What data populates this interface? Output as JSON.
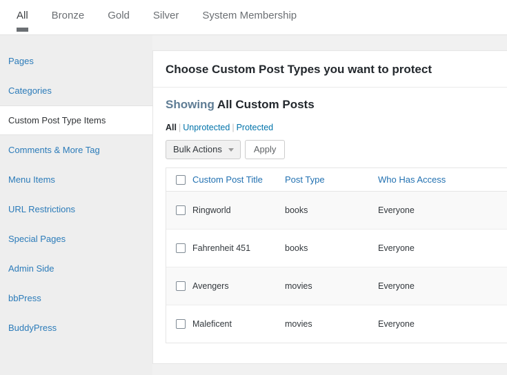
{
  "tabs": [
    {
      "label": "All",
      "active": true
    },
    {
      "label": "Bronze",
      "active": false
    },
    {
      "label": "Gold",
      "active": false
    },
    {
      "label": "Silver",
      "active": false
    },
    {
      "label": "System Membership",
      "active": false
    }
  ],
  "sidebar": {
    "items": [
      {
        "label": "Pages",
        "active": false
      },
      {
        "label": "Categories",
        "active": false
      },
      {
        "label": "Custom Post Type Items",
        "active": true
      },
      {
        "label": "Comments & More Tag",
        "active": false
      },
      {
        "label": "Menu Items",
        "active": false
      },
      {
        "label": "URL Restrictions",
        "active": false
      },
      {
        "label": "Special Pages",
        "active": false
      },
      {
        "label": "Admin Side",
        "active": false
      },
      {
        "label": "bbPress",
        "active": false
      },
      {
        "label": "BuddyPress",
        "active": false
      }
    ]
  },
  "panel": {
    "title": "Choose Custom Post Types you want to protect",
    "showing_label": "Showing",
    "showing_value": "All Custom Posts",
    "filters": [
      {
        "label": "All",
        "current": true
      },
      {
        "label": "Unprotected",
        "current": false
      },
      {
        "label": "Protected",
        "current": false
      }
    ],
    "filter_separator": "|",
    "bulk_actions_label": "Bulk Actions",
    "bulk_actions_options": [
      "Bulk Actions"
    ],
    "apply_label": "Apply",
    "table": {
      "columns": [
        "Custom Post Title",
        "Post Type",
        "Who Has Access"
      ],
      "rows": [
        {
          "title": "Ringworld",
          "post_type": "books",
          "access": "Everyone"
        },
        {
          "title": "Fahrenheit 451",
          "post_type": "books",
          "access": "Everyone"
        },
        {
          "title": "Avengers",
          "post_type": "movies",
          "access": "Everyone"
        },
        {
          "title": "Maleficent",
          "post_type": "movies",
          "access": "Everyone"
        }
      ]
    }
  },
  "colors": {
    "link": "#2271b1",
    "sidebar_link": "#2b7bb9",
    "muted": "#b4b9be",
    "heading": "#23282d"
  }
}
